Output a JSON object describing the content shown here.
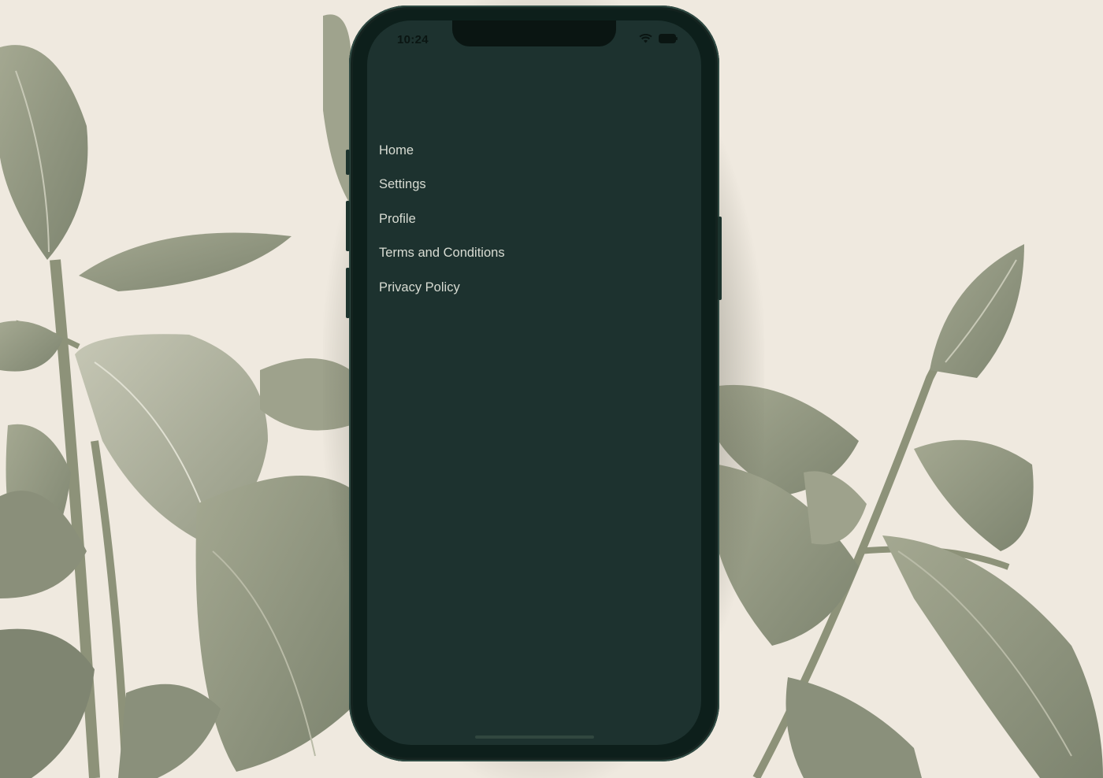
{
  "status_bar": {
    "time": "10:24"
  },
  "menu": {
    "items": [
      {
        "label": "Home"
      },
      {
        "label": "Settings"
      },
      {
        "label": "Profile"
      },
      {
        "label": "Terms and Conditions"
      },
      {
        "label": "Privacy Policy"
      }
    ]
  },
  "colors": {
    "background": "#efe9df",
    "screen": "#1d322f",
    "menu_text": "#d8dcd3",
    "leaf": "#8f9580"
  },
  "icons": [
    "wifi-icon",
    "battery-icon"
  ]
}
